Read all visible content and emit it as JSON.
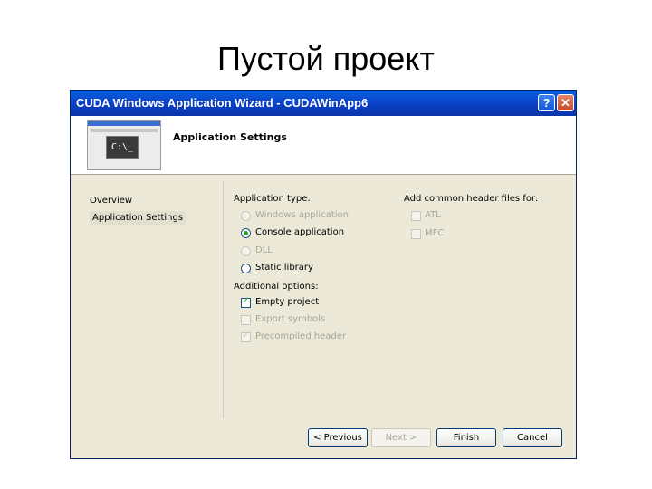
{
  "slide": {
    "title": "Пустой проект"
  },
  "window": {
    "title": "CUDA Windows Application Wizard - CUDAWinApp6",
    "help_glyph": "?",
    "close_glyph": "✕"
  },
  "header": {
    "title": "Application Settings",
    "thumbnail_prompt": "C:\\_"
  },
  "nav": {
    "overview": "Overview",
    "settings": "Application Settings"
  },
  "app_type": {
    "heading": "Application type:",
    "options": [
      {
        "label": "Windows application",
        "checked": false,
        "enabled": false
      },
      {
        "label": "Console application",
        "checked": true,
        "enabled": true
      },
      {
        "label": "DLL",
        "checked": false,
        "enabled": false
      },
      {
        "label": "Static library",
        "checked": false,
        "enabled": true
      }
    ]
  },
  "additional": {
    "heading": "Additional options:",
    "options": [
      {
        "label": "Empty project",
        "checked": true,
        "enabled": true
      },
      {
        "label": "Export symbols",
        "checked": false,
        "enabled": false
      },
      {
        "label": "Precompiled header",
        "checked": true,
        "enabled": false
      }
    ]
  },
  "headers": {
    "heading": "Add common header files for:",
    "options": [
      {
        "label": "ATL",
        "checked": false,
        "enabled": false
      },
      {
        "label": "MFC",
        "checked": false,
        "enabled": false
      }
    ]
  },
  "buttons": {
    "previous": "< Previous",
    "next": "Next >",
    "finish": "Finish",
    "cancel": "Cancel"
  }
}
